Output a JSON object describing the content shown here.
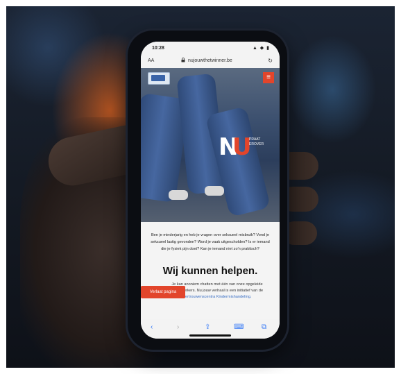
{
  "status_bar": {
    "time": "10:28",
    "icons": "▲ ◆ ▮"
  },
  "browser": {
    "aa_label": "AA",
    "lock_icon": "lock-icon",
    "url": "nujouwthetwinner.be",
    "reload_symbol": "↻"
  },
  "site": {
    "menu_symbol": "≡",
    "logo": {
      "n": "N",
      "u": "U",
      "tagline": "PRAAT\nEROVER"
    },
    "intro": "Ben je minderjarig en heb je vragen over seksueel misbruik? Vond je seksueel lastig gevonden? Word je vaak uitgescholden? Is er iemand die je fysiek pijn doet? Kan je iemand niet zo'n praktisch?",
    "heading": "Wij kunnen helpen.",
    "body_text": "Je kan anoniem chatten met één van onze opgeleide medewerkers. Nu jouw verhaal is een initiatief van de",
    "body_link": "Vertrouwenscentra Kindermishandeling.",
    "cta_label": "Verlaat pagina"
  },
  "toolbar": {
    "back": "‹",
    "forward": "›",
    "share": "⇪",
    "bookmarks": "⌨",
    "tabs": "⧉"
  },
  "colors": {
    "accent": "#e2452b",
    "link": "#3a6fc4",
    "ios_blue": "#3478f6"
  }
}
